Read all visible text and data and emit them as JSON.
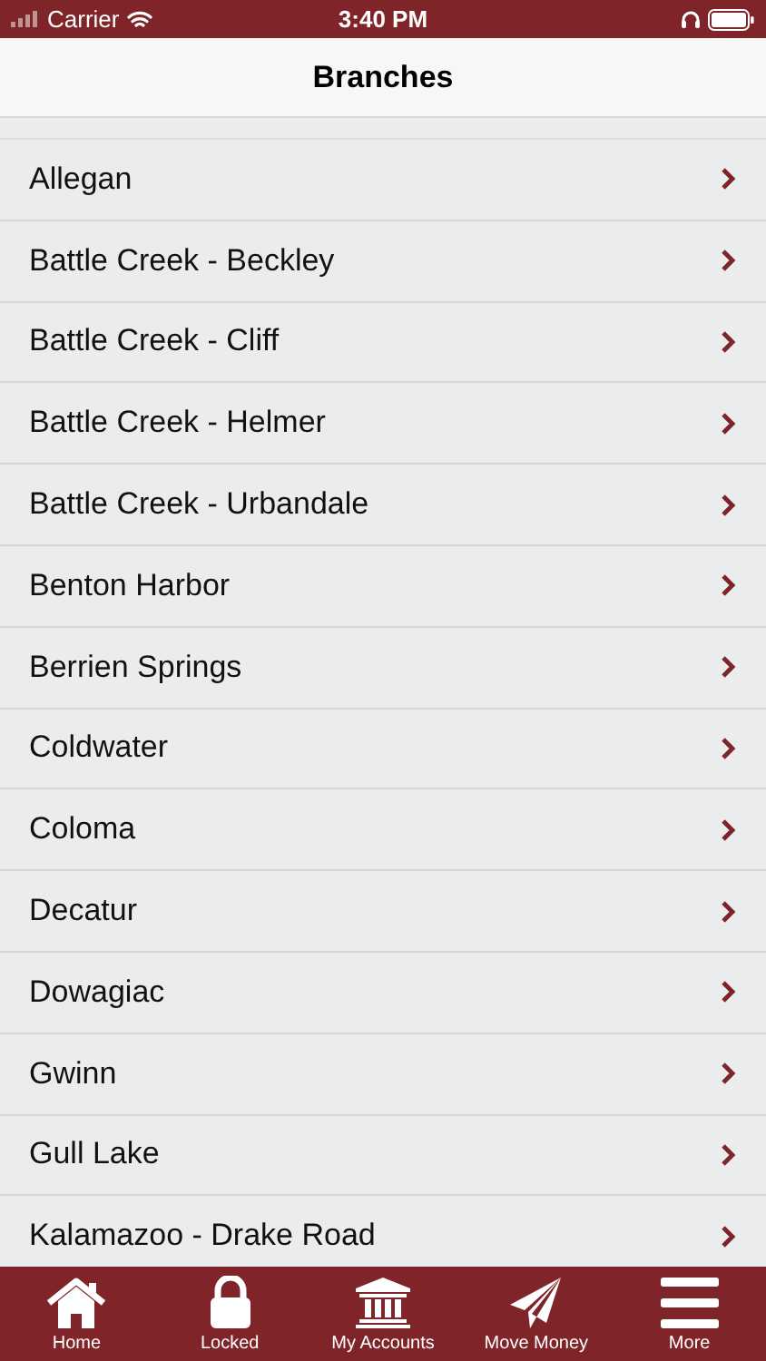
{
  "status_bar": {
    "carrier": "Carrier",
    "time": "3:40 PM"
  },
  "nav_bar": {
    "title": "Branches"
  },
  "branches": [
    {
      "name": "Allegan"
    },
    {
      "name": "Battle Creek - Beckley"
    },
    {
      "name": "Battle Creek - Cliff"
    },
    {
      "name": "Battle Creek - Helmer"
    },
    {
      "name": "Battle Creek - Urbandale"
    },
    {
      "name": "Benton Harbor"
    },
    {
      "name": "Berrien Springs"
    },
    {
      "name": "Coldwater"
    },
    {
      "name": "Coloma"
    },
    {
      "name": "Decatur"
    },
    {
      "name": "Dowagiac"
    },
    {
      "name": "Gwinn"
    },
    {
      "name": "Gull Lake"
    },
    {
      "name": "Kalamazoo - Drake Road"
    }
  ],
  "tab_bar": [
    {
      "label": "Home",
      "kind": "home"
    },
    {
      "label": "Locked",
      "kind": "lock"
    },
    {
      "label": "My Accounts",
      "kind": "bank"
    },
    {
      "label": "Move Money",
      "kind": "send"
    },
    {
      "label": "More",
      "kind": "menu"
    }
  ]
}
